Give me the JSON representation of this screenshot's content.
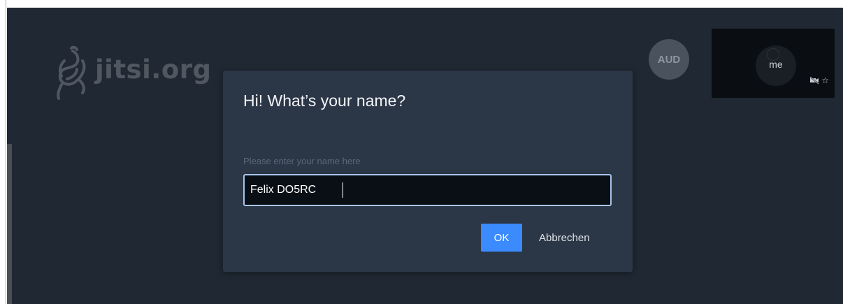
{
  "watermark": {
    "text": "jitsi.org"
  },
  "participants": {
    "aud_initials": "AUD"
  },
  "local_thumbnail": {
    "label": "me",
    "icons": [
      "video-off-icon",
      "star-icon"
    ]
  },
  "dialog": {
    "title": "Hi! What’s your name?",
    "input_placeholder": "Please enter your name here",
    "input_value": "Felix DO5RC",
    "ok_label": "OK",
    "cancel_label": "Abbrechen"
  },
  "colors": {
    "stage_background": "#1f2833",
    "dialog_background": "#2b3646",
    "primary_button": "#3b8bff",
    "input_border_focus": "#a7c6ec"
  }
}
